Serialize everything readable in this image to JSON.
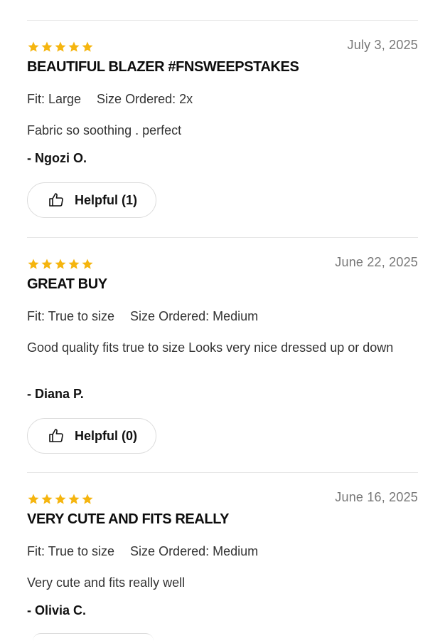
{
  "reviews": [
    {
      "rating": 5,
      "date": "July 3, 2025",
      "title": "BEAUTIFUL BLAZER #FNSWEEPSTAKES",
      "fit": "Fit: Large",
      "size": "Size Ordered: 2x",
      "body": "Fabric so soothing . perfect",
      "author": "- Ngozi O.",
      "helpful": "Helpful (1)"
    },
    {
      "rating": 5,
      "date": "June 22, 2025",
      "title": "GREAT BUY",
      "fit": "Fit: True to size",
      "size": "Size Ordered: Medium",
      "body": "Good quality fits true to size Looks very nice dressed up or down",
      "author": "- Diana P.",
      "helpful": "Helpful (0)"
    },
    {
      "rating": 5,
      "date": "June 16, 2025",
      "title": "VERY CUTE AND FITS REALLY",
      "fit": "Fit: True to size",
      "size": "Size Ordered: Medium",
      "body": "Very cute and fits really well",
      "author": "- Olivia C."
    }
  ],
  "icons": {
    "star": "star-icon",
    "helpful": "thumbs-up-icon"
  },
  "colors": {
    "star": "#F5B50F",
    "divider": "#E6E6E6",
    "date": "#777777"
  }
}
